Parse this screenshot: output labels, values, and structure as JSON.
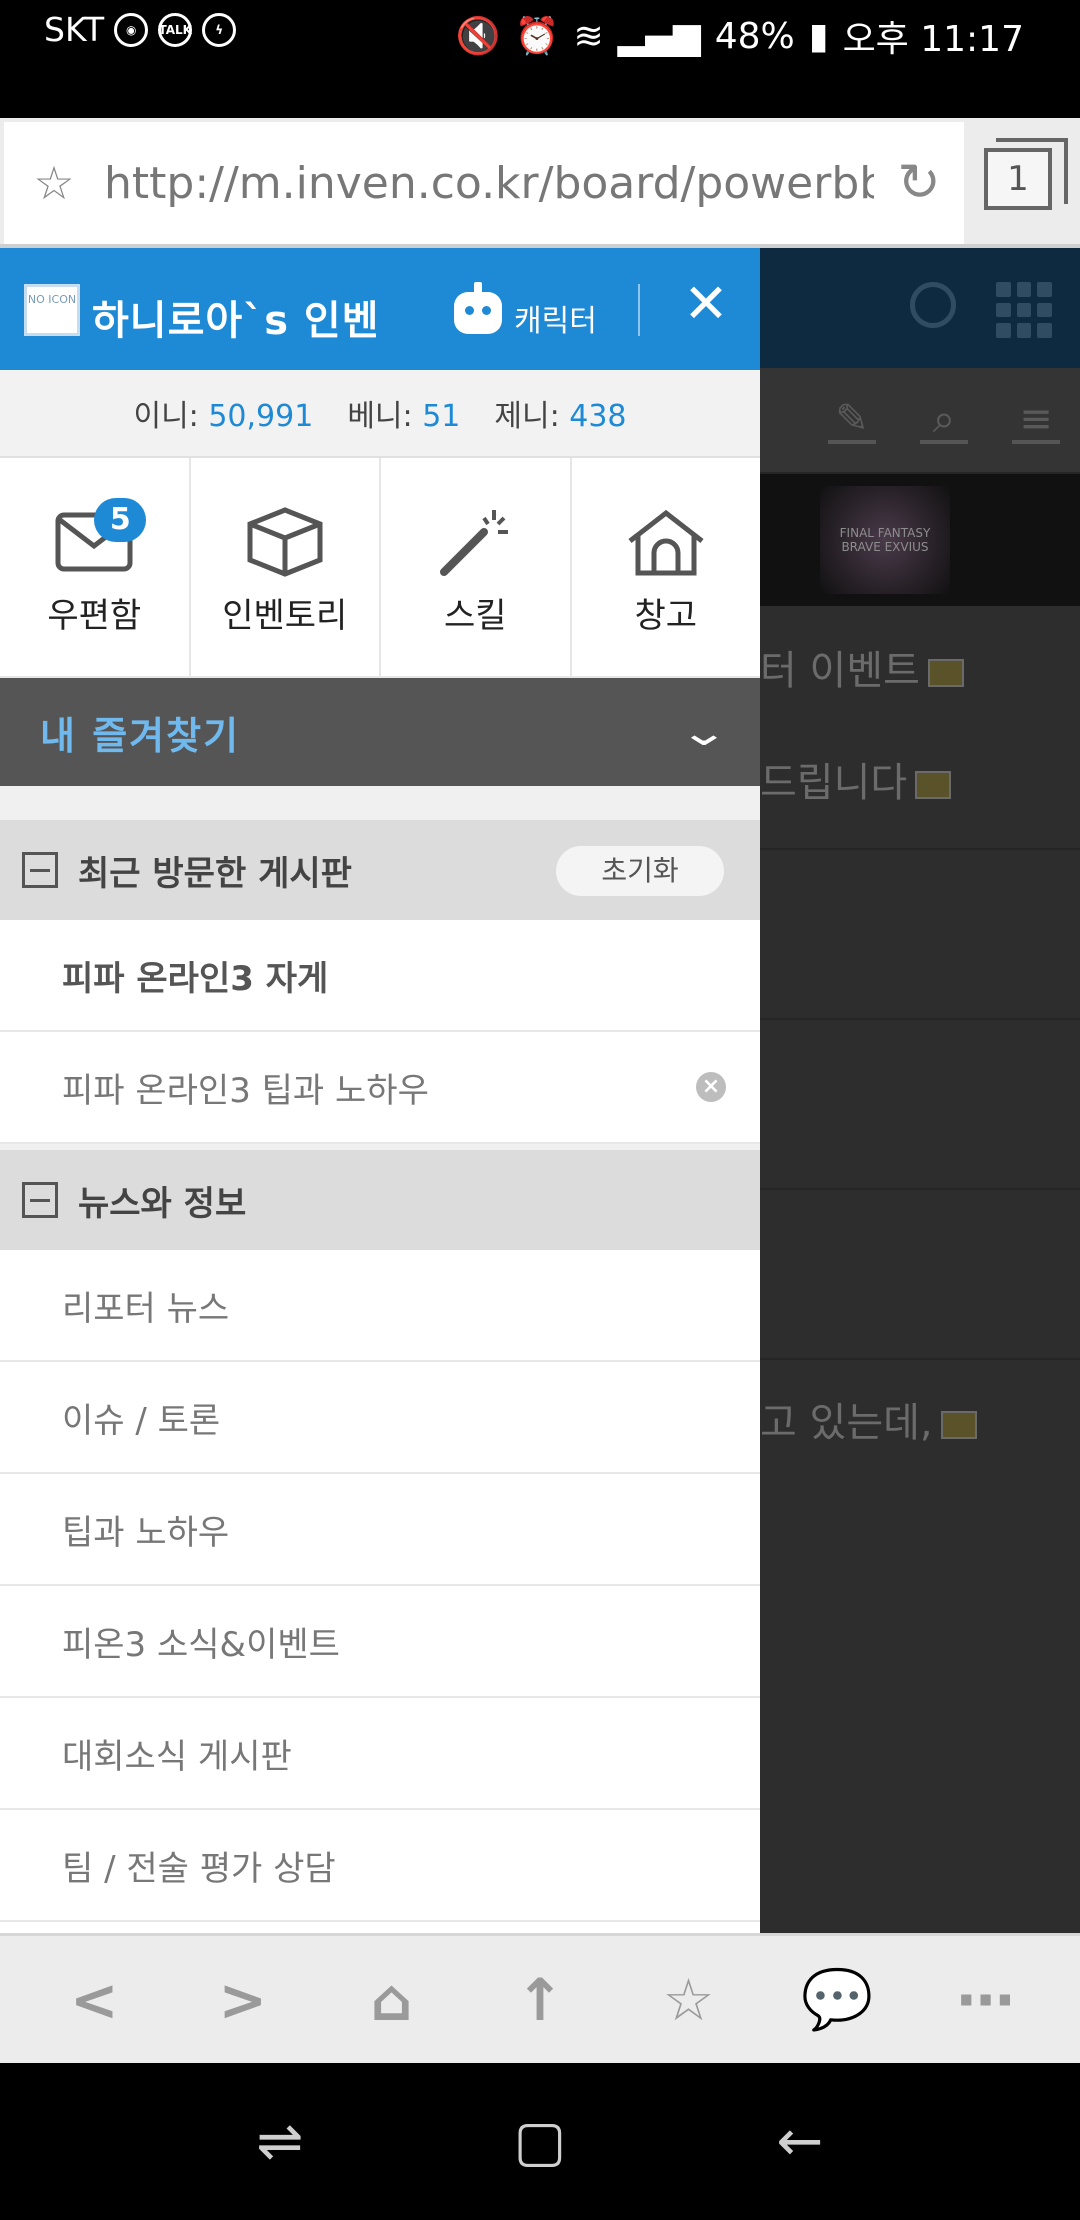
{
  "status_bar": {
    "carrier": "SKT",
    "notification_icons": [
      "bot-icon",
      "talk-icon",
      "messenger-icon"
    ],
    "battery": "48%",
    "time": "오후 11:17",
    "talk_label": "TALK"
  },
  "browser": {
    "url": "http://m.inven.co.kr/board/powerbbs.",
    "tab_count": "1"
  },
  "drawer": {
    "no_icon_label": "NO ICON",
    "title": "하니로아`s 인벤",
    "character_label": "캐릭터",
    "close_symbol": "✕",
    "currency": {
      "ini_label": "이니:",
      "ini_value": "50,991",
      "beni_label": "베니:",
      "beni_value": "51",
      "jeni_label": "제니:",
      "jeni_value": "438"
    },
    "quick_menu": [
      {
        "label": "우편함",
        "icon": "mail-icon",
        "badge": "5"
      },
      {
        "label": "인벤토리",
        "icon": "box-icon"
      },
      {
        "label": "스킬",
        "icon": "magic-wand-icon"
      },
      {
        "label": "창고",
        "icon": "house-icon"
      }
    ],
    "favorites_title": "내 즐겨찾기",
    "recent": {
      "title": "최근 방문한 게시판",
      "reset_label": "초기화",
      "items": [
        "피파 온라인3 자게",
        "피파 온라인3 팁과 노하우"
      ]
    },
    "news": {
      "title": "뉴스와 정보",
      "items": [
        "리포터 뉴스",
        "이슈 / 토론",
        "팁과 노하우",
        "피온3 소식&이벤트",
        "대회소식 게시판",
        "팀 / 전술 평가 상담"
      ]
    }
  },
  "background_page": {
    "lines": [
      "터 이벤트",
      "드립니다",
      "고 있는데,"
    ],
    "banner_text": "FINAL FANTASY BRAVE EXVIUS"
  },
  "browser_nav": [
    "back-icon",
    "forward-icon",
    "home-icon",
    "scroll-top-icon",
    "bookmark-icon",
    "chat-icon",
    "more-icon"
  ],
  "colors": {
    "accent": "#1e8ad6",
    "favorites_text": "#6fb9ef"
  }
}
